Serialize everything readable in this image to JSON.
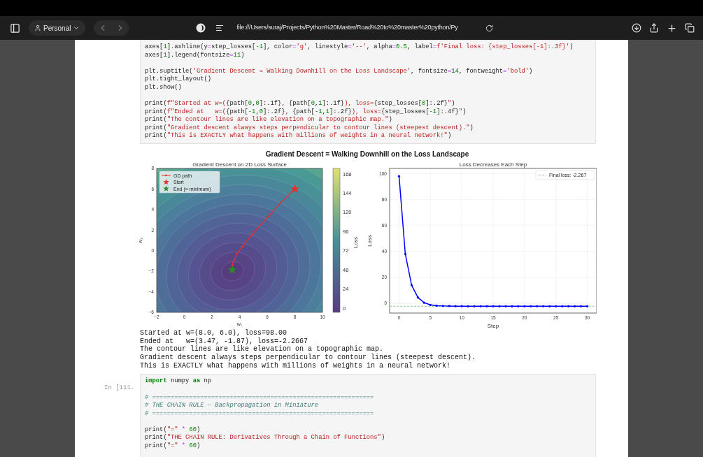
{
  "browser": {
    "profile": "Personal",
    "address": "file:///Users/suraj/Projects/Python%20Master/Road%20to%20master%20python/Py"
  },
  "cells": [
    {
      "code_blocks": [
        [
          [
            {
              "text": "axes[",
              "kind": "n"
            },
            {
              "text": "1",
              "kind": "d"
            },
            {
              "text": "].axhline(y",
              "kind": "n"
            },
            {
              "text": "=",
              "kind": "o"
            },
            {
              "text": "step_losses[",
              "kind": "n"
            },
            {
              "text": "-1",
              "kind": "d"
            },
            {
              "text": "], color",
              "kind": "n"
            },
            {
              "text": "=",
              "kind": "o"
            },
            {
              "text": "'g'",
              "kind": "s"
            },
            {
              "text": ", linestyle",
              "kind": "n"
            },
            {
              "text": "=",
              "kind": "o"
            },
            {
              "text": "'--'",
              "kind": "s"
            },
            {
              "text": ", alpha",
              "kind": "n"
            },
            {
              "text": "=",
              "kind": "o"
            },
            {
              "text": "0.5",
              "kind": "d"
            },
            {
              "text": ", label",
              "kind": "n"
            },
            {
              "text": "=",
              "kind": "o"
            },
            {
              "text": "f'Final loss: {step_losses[-1]:.3f}'",
              "kind": "s"
            },
            {
              "text": ")",
              "kind": "n"
            }
          ],
          [
            {
              "text": "axes[",
              "kind": "n"
            },
            {
              "text": "1",
              "kind": "d"
            },
            {
              "text": "].legend(fontsize",
              "kind": "n"
            },
            {
              "text": "=",
              "kind": "o"
            },
            {
              "text": "11",
              "kind": "d"
            },
            {
              "text": ")",
              "kind": "n"
            }
          ]
        ],
        [
          [
            {
              "text": "plt.suptitle(",
              "kind": "n"
            },
            {
              "text": "'Gradient Descent = Walking Downhill on the Loss Landscape'",
              "kind": "s"
            },
            {
              "text": ", fontsize",
              "kind": "n"
            },
            {
              "text": "=",
              "kind": "o"
            },
            {
              "text": "14",
              "kind": "d"
            },
            {
              "text": ", fontweight",
              "kind": "n"
            },
            {
              "text": "=",
              "kind": "o"
            },
            {
              "text": "'bold'",
              "kind": "s"
            },
            {
              "text": ")",
              "kind": "n"
            }
          ],
          [
            {
              "text": "plt.tight_layout()",
              "kind": "n"
            }
          ],
          [
            {
              "text": "plt.show()",
              "kind": "n"
            }
          ]
        ],
        [
          [
            {
              "text": "print(",
              "kind": "n"
            },
            {
              "text": "f\"Started at w=(",
              "kind": "s"
            },
            {
              "text": "{path[",
              "kind": "n"
            },
            {
              "text": "0",
              "kind": "d"
            },
            {
              "text": ",",
              "kind": "n"
            },
            {
              "text": "0",
              "kind": "d"
            },
            {
              "text": "]:.1f}",
              "kind": "n"
            },
            {
              "text": ", ",
              "kind": "s"
            },
            {
              "text": "{path[",
              "kind": "n"
            },
            {
              "text": "0",
              "kind": "d"
            },
            {
              "text": ",",
              "kind": "n"
            },
            {
              "text": "1",
              "kind": "d"
            },
            {
              "text": "]:.1f}",
              "kind": "n"
            },
            {
              "text": "), loss=",
              "kind": "s"
            },
            {
              "text": "{step_losses[",
              "kind": "n"
            },
            {
              "text": "0",
              "kind": "d"
            },
            {
              "text": "]:.2f}",
              "kind": "n"
            },
            {
              "text": "\"",
              "kind": "s"
            },
            {
              "text": ")",
              "kind": "n"
            }
          ],
          [
            {
              "text": "print(",
              "kind": "n"
            },
            {
              "text": "f\"Ended at   w=(",
              "kind": "s"
            },
            {
              "text": "{path[",
              "kind": "n"
            },
            {
              "text": "-1",
              "kind": "d"
            },
            {
              "text": ",",
              "kind": "n"
            },
            {
              "text": "0",
              "kind": "d"
            },
            {
              "text": "]:.2f}",
              "kind": "n"
            },
            {
              "text": ", ",
              "kind": "s"
            },
            {
              "text": "{path[",
              "kind": "n"
            },
            {
              "text": "-1",
              "kind": "d"
            },
            {
              "text": ",",
              "kind": "n"
            },
            {
              "text": "1",
              "kind": "d"
            },
            {
              "text": "]:.2f}",
              "kind": "n"
            },
            {
              "text": "), loss=",
              "kind": "s"
            },
            {
              "text": "{step_losses[",
              "kind": "n"
            },
            {
              "text": "-1",
              "kind": "d"
            },
            {
              "text": "]:.4f}",
              "kind": "n"
            },
            {
              "text": "\"",
              "kind": "s"
            },
            {
              "text": ")",
              "kind": "n"
            }
          ],
          [
            {
              "text": "print(",
              "kind": "n"
            },
            {
              "text": "\"The contour lines are like elevation on a topographic map.\"",
              "kind": "s"
            },
            {
              "text": ")",
              "kind": "n"
            }
          ],
          [
            {
              "text": "print(",
              "kind": "n"
            },
            {
              "text": "\"Gradient descent always steps perpendicular to contour lines (steepest descent).\"",
              "kind": "s"
            },
            {
              "text": ")",
              "kind": "n"
            }
          ],
          [
            {
              "text": "print(",
              "kind": "n"
            },
            {
              "text": "\"This is EXACTLY what happens with millions of weights in a neural network!\"",
              "kind": "s"
            },
            {
              "text": ")",
              "kind": "n"
            }
          ]
        ]
      ],
      "figure": {
        "title": "Gradient Descent = Walking Downhill on the Loss Landscape",
        "contour_plot": {
          "legend": [
            "Start",
            "End (= minimum)"
          ],
          "colorbar": {
            "label": "Loss",
            "ticks": [
              "168",
              "144",
              "120",
              "96",
              "72",
              "48",
              "24",
              "0"
            ]
          },
          "chart_data": {
            "type": "line",
            "title": "Gradient Descent on 2D Loss Surface",
            "xlabel": "w₁",
            "ylabel": "w₂",
            "x": [
              8,
              7,
              6.05,
              4.9,
              4.2,
              3.8,
              3.65,
              3.55,
              3.5,
              3.47
            ],
            "series": [
              {
                "name": "GD path",
                "color": "#e8302a",
                "values": [
                  6,
                  4.7,
                  3.3,
                  1.55,
                  0.4,
                  -0.3,
                  -0.8,
                  -1.1,
                  -1.4,
                  -1.87
                ]
              }
            ],
            "xlim": [
              -2,
              10
            ],
            "ylim": [
              -6,
              8
            ],
            "xticks": [
              {
                "value": -2,
                "label": "−2"
              },
              0,
              2,
              4,
              6,
              8,
              10
            ],
            "yticks": [
              {
                "value": -6,
                "label": "−6"
              },
              {
                "value": -4,
                "label": "−4"
              },
              {
                "value": -2,
                "label": "−2"
              },
              0,
              2,
              4,
              6,
              8
            ]
          }
        },
        "loss_plot": {
          "chart_data": {
            "type": "line",
            "title": "Loss Decreases Each Step",
            "xlabel": "Step",
            "ylabel": "Loss",
            "x": [
              0,
              1,
              2,
              3,
              4,
              5,
              6,
              7,
              8,
              9,
              10,
              11,
              12,
              13,
              14,
              15,
              16,
              17,
              18,
              19,
              20,
              21,
              22,
              23,
              24,
              25,
              26,
              27,
              28,
              29,
              30
            ],
            "series": [
              {
                "color": "#0000ff",
                "values": [
                  98,
                  38,
                  14,
                  4.5,
                  0.5,
                  -1.2,
                  -1.8,
                  -2,
                  -2.1,
                  -2.2,
                  -2.2,
                  -2.3,
                  -2.3,
                  -2.3,
                  -2.3,
                  -2.3,
                  -2.3,
                  -2.3,
                  -2.3,
                  -2.3,
                  -2.3,
                  -2.3,
                  -2.3,
                  -2.3,
                  -2.3,
                  -2.3,
                  -2.3,
                  -2.3,
                  -2.3,
                  -2.3,
                  -2.3
                ]
              }
            ],
            "xlim": [
              -1.5,
              31.5
            ],
            "ylim": [
              -7.5,
              104
            ],
            "xticks": [
              0,
              5,
              10,
              15,
              20,
              25,
              30
            ],
            "yticks": [
              0,
              20,
              40,
              60,
              80,
              100
            ],
            "grid": true,
            "ref_lines": [
              {
                "axis": "y",
                "value": -2.267,
                "label": "Final loss: -2.267"
              }
            ]
          }
        }
      },
      "output": [
        "Started at w=(8.0, 6.0), loss=98.00",
        "Ended at   w=(3.47, -1.87), loss=-2.2667",
        "The contour lines are like elevation on a topographic map.",
        "Gradient descent always steps perpendicular to contour lines (steepest descent).",
        "This is EXACTLY what happens with millions of weights in a neural network!"
      ]
    },
    {
      "prompt": "In [111…",
      "code_blocks": [
        [
          [
            {
              "text": "import",
              "kind": "k"
            },
            {
              "text": " numpy ",
              "kind": "n"
            },
            {
              "text": "as",
              "kind": "k"
            },
            {
              "text": " np",
              "kind": "n"
            }
          ]
        ],
        [
          [
            {
              "text": "# ============================================================",
              "kind": "c"
            }
          ],
          [
            {
              "text": "# THE CHAIN RULE — Backpropagation in Miniature",
              "kind": "c"
            }
          ],
          [
            {
              "text": "# ============================================================",
              "kind": "c"
            }
          ]
        ],
        [
          [
            {
              "text": "print(",
              "kind": "n"
            },
            {
              "text": "\"=\"",
              "kind": "s"
            },
            {
              "text": " * ",
              "kind": "o"
            },
            {
              "text": "60",
              "kind": "d"
            },
            {
              "text": ")",
              "kind": "n"
            }
          ],
          [
            {
              "text": "print(",
              "kind": "n"
            },
            {
              "text": "\"THE CHAIN RULE: Derivatives Through a Chain of Functions\"",
              "kind": "s"
            },
            {
              "text": ")",
              "kind": "n"
            }
          ],
          [
            {
              "text": "print(",
              "kind": "n"
            },
            {
              "text": "\"=\"",
              "kind": "s"
            },
            {
              "text": " * ",
              "kind": "o"
            },
            {
              "text": "60",
              "kind": "d"
            },
            {
              "text": ")",
              "kind": "n"
            }
          ]
        ]
      ]
    }
  ]
}
